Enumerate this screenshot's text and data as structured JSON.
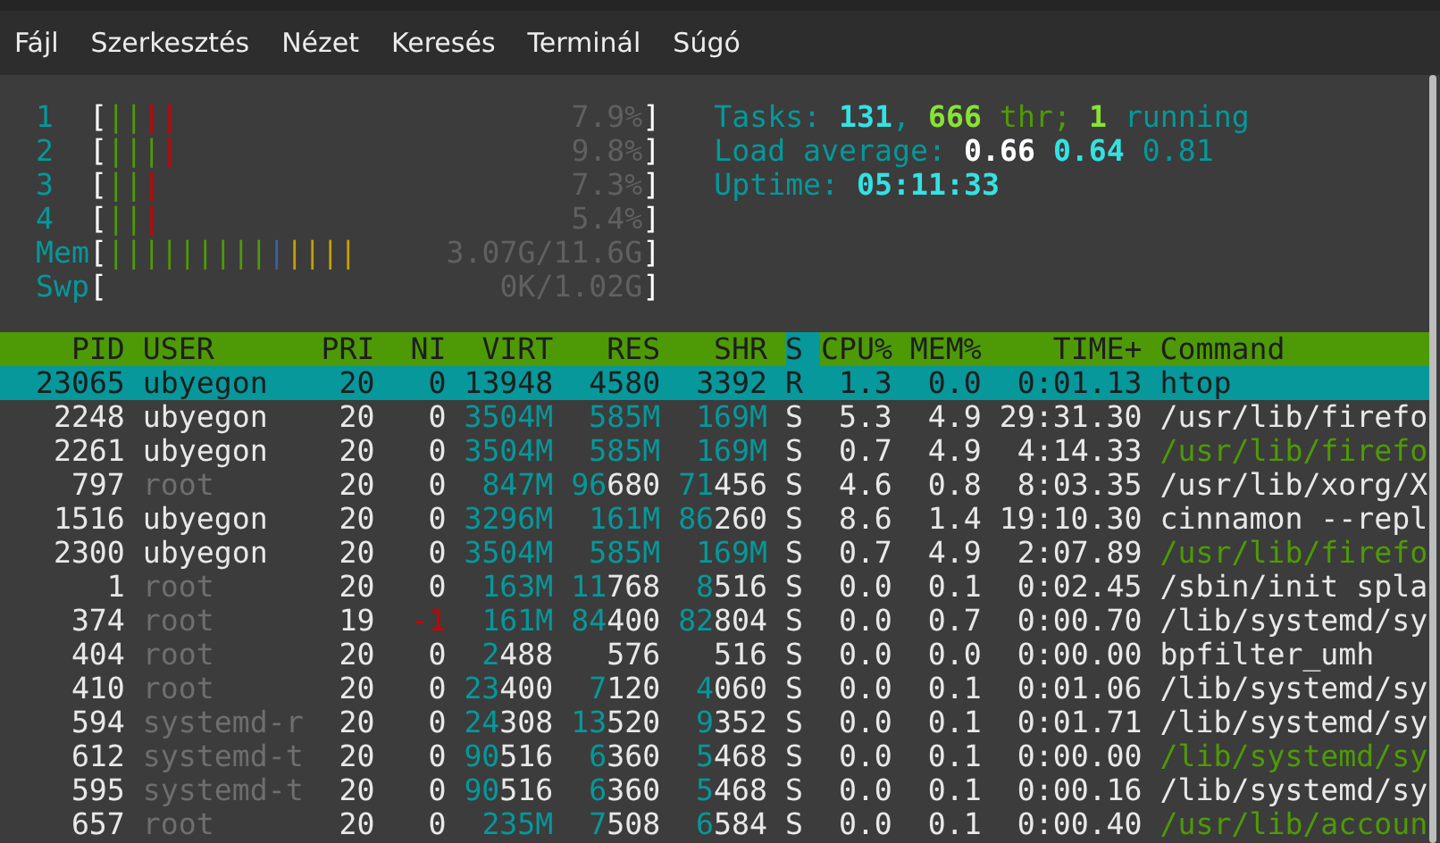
{
  "menu": [
    {
      "label": "Fájl"
    },
    {
      "label": "Szerkesztés"
    },
    {
      "label": "Nézet"
    },
    {
      "label": "Keresés"
    },
    {
      "label": "Terminál"
    },
    {
      "label": "Súgó"
    }
  ],
  "meters": [
    {
      "label": "1",
      "brackets": [
        "[",
        "]"
      ],
      "segments": [
        {
          "color": "#4e9a06",
          "text": "||"
        },
        {
          "color": "#cc0000",
          "text": "||"
        }
      ],
      "value": "7.9%"
    },
    {
      "label": "2",
      "brackets": [
        "[",
        "]"
      ],
      "segments": [
        {
          "color": "#4e9a06",
          "text": "|||"
        },
        {
          "color": "#cc0000",
          "text": "|"
        }
      ],
      "value": "9.8%"
    },
    {
      "label": "3",
      "brackets": [
        "[",
        "]"
      ],
      "segments": [
        {
          "color": "#4e9a06",
          "text": "||"
        },
        {
          "color": "#cc0000",
          "text": "|"
        }
      ],
      "value": "7.3%"
    },
    {
      "label": "4",
      "brackets": [
        "[",
        "]"
      ],
      "segments": [
        {
          "color": "#4e9a06",
          "text": "||"
        },
        {
          "color": "#cc0000",
          "text": "|"
        }
      ],
      "value": "5.4%"
    },
    {
      "label": "Mem",
      "brackets": [
        "[",
        "]"
      ],
      "segments": [
        {
          "color": "#4e9a06",
          "text": "|||||||||"
        },
        {
          "color": "#3465a4",
          "text": "|"
        },
        {
          "color": "#c4a000",
          "text": "||||"
        }
      ],
      "value": "3.07G/11.6G"
    },
    {
      "label": "Swp",
      "brackets": [
        "[",
        "]"
      ],
      "value": "0K/1.02G"
    }
  ],
  "summary": [
    [
      {
        "text": "Tasks: ",
        "kind": "label"
      },
      {
        "text": "131",
        "kind": "count"
      },
      {
        "text": ", ",
        "kind": "label"
      },
      {
        "text": "666",
        "kind": "threads"
      },
      {
        "text": " thr; ",
        "kind": "thread-label"
      },
      {
        "text": "1",
        "kind": "threads"
      },
      {
        "text": " running",
        "kind": "label"
      }
    ],
    [
      {
        "text": "Load average: ",
        "kind": "label"
      },
      {
        "text": "0.66",
        "kind": "strong"
      },
      {
        "text": " 0.64",
        "kind": "count"
      },
      {
        "text": " 0.81",
        "kind": "label"
      }
    ],
    [
      {
        "text": "Uptime: ",
        "kind": "label"
      },
      {
        "text": "05:11:33",
        "kind": "count"
      }
    ]
  ],
  "table": {
    "columns": [
      {
        "label": "PID",
        "sorted": false
      },
      {
        "label": "USER",
        "sorted": false
      },
      {
        "label": "PRI",
        "sorted": false
      },
      {
        "label": "NI",
        "sorted": false
      },
      {
        "label": "VIRT",
        "sorted": false
      },
      {
        "label": "RES",
        "sorted": false
      },
      {
        "label": "SHR",
        "sorted": false
      },
      {
        "label": "S",
        "sorted": true
      },
      {
        "label": "CPU%",
        "sorted": false
      },
      {
        "label": "MEM%",
        "sorted": false
      },
      {
        "label": "TIME+",
        "sorted": false
      },
      {
        "label": "Command",
        "sorted": false
      }
    ],
    "rows": [
      {
        "cells": [
          "23065",
          "ubyegon",
          "20",
          "0",
          "13948",
          "4580",
          "3392",
          "R",
          "1.3",
          "0.0",
          "0:01.13",
          "htop"
        ],
        "selected": true,
        "other_user": false,
        "thread": false,
        "niced": false
      },
      {
        "cells": [
          "2248",
          "ubyegon",
          "20",
          "0",
          "3504M",
          "585M",
          "169M",
          "S",
          "5.3",
          "4.9",
          "29:31.30",
          "/usr/lib/firefo"
        ],
        "selected": false,
        "other_user": false,
        "thread": false,
        "niced": false
      },
      {
        "cells": [
          "2261",
          "ubyegon",
          "20",
          "0",
          "3504M",
          "585M",
          "169M",
          "S",
          "0.7",
          "4.9",
          "4:14.33",
          "/usr/lib/firefo"
        ],
        "selected": false,
        "other_user": false,
        "thread": true,
        "niced": false
      },
      {
        "cells": [
          "797",
          "root",
          "20",
          "0",
          "847M",
          "96680",
          "71456",
          "S",
          "4.6",
          "0.8",
          "8:03.35",
          "/usr/lib/xorg/X"
        ],
        "selected": false,
        "other_user": true,
        "thread": false,
        "niced": false
      },
      {
        "cells": [
          "1516",
          "ubyegon",
          "20",
          "0",
          "3296M",
          "161M",
          "86260",
          "S",
          "8.6",
          "1.4",
          "19:10.30",
          "cinnamon --repl"
        ],
        "selected": false,
        "other_user": false,
        "thread": false,
        "niced": false
      },
      {
        "cells": [
          "2300",
          "ubyegon",
          "20",
          "0",
          "3504M",
          "585M",
          "169M",
          "S",
          "0.7",
          "4.9",
          "2:07.89",
          "/usr/lib/firefo"
        ],
        "selected": false,
        "other_user": false,
        "thread": true,
        "niced": false
      },
      {
        "cells": [
          "1",
          "root",
          "20",
          "0",
          "163M",
          "11768",
          "8516",
          "S",
          "0.0",
          "0.1",
          "0:02.45",
          "/sbin/init spla"
        ],
        "selected": false,
        "other_user": true,
        "thread": false,
        "niced": false
      },
      {
        "cells": [
          "374",
          "root",
          "19",
          "-1",
          "161M",
          "84400",
          "82804",
          "S",
          "0.0",
          "0.7",
          "0:00.70",
          "/lib/systemd/sy"
        ],
        "selected": false,
        "other_user": true,
        "thread": false,
        "niced": true
      },
      {
        "cells": [
          "404",
          "root",
          "20",
          "0",
          "2488",
          "576",
          "516",
          "S",
          "0.0",
          "0.0",
          "0:00.00",
          "bpfilter_umh"
        ],
        "selected": false,
        "other_user": true,
        "thread": false,
        "niced": false
      },
      {
        "cells": [
          "410",
          "root",
          "20",
          "0",
          "23400",
          "7120",
          "4060",
          "S",
          "0.0",
          "0.1",
          "0:01.06",
          "/lib/systemd/sy"
        ],
        "selected": false,
        "other_user": true,
        "thread": false,
        "niced": false
      },
      {
        "cells": [
          "594",
          "systemd-r",
          "20",
          "0",
          "24308",
          "13520",
          "9352",
          "S",
          "0.0",
          "0.1",
          "0:01.71",
          "/lib/systemd/sy"
        ],
        "selected": false,
        "other_user": true,
        "thread": false,
        "niced": false
      },
      {
        "cells": [
          "612",
          "systemd-t",
          "20",
          "0",
          "90516",
          "6360",
          "5468",
          "S",
          "0.0",
          "0.1",
          "0:00.00",
          "/lib/systemd/sy"
        ],
        "selected": false,
        "other_user": true,
        "thread": true,
        "niced": false
      },
      {
        "cells": [
          "595",
          "systemd-t",
          "20",
          "0",
          "90516",
          "6360",
          "5468",
          "S",
          "0.0",
          "0.1",
          "0:00.16",
          "/lib/systemd/sy"
        ],
        "selected": false,
        "other_user": true,
        "thread": false,
        "niced": false
      },
      {
        "cells": [
          "657",
          "root",
          "20",
          "0",
          "235M",
          "7508",
          "6584",
          "S",
          "0.0",
          "0.1",
          "0:00.40",
          "/usr/lib/accoun"
        ],
        "selected": false,
        "other_user": true,
        "thread": true,
        "niced": false
      }
    ]
  }
}
